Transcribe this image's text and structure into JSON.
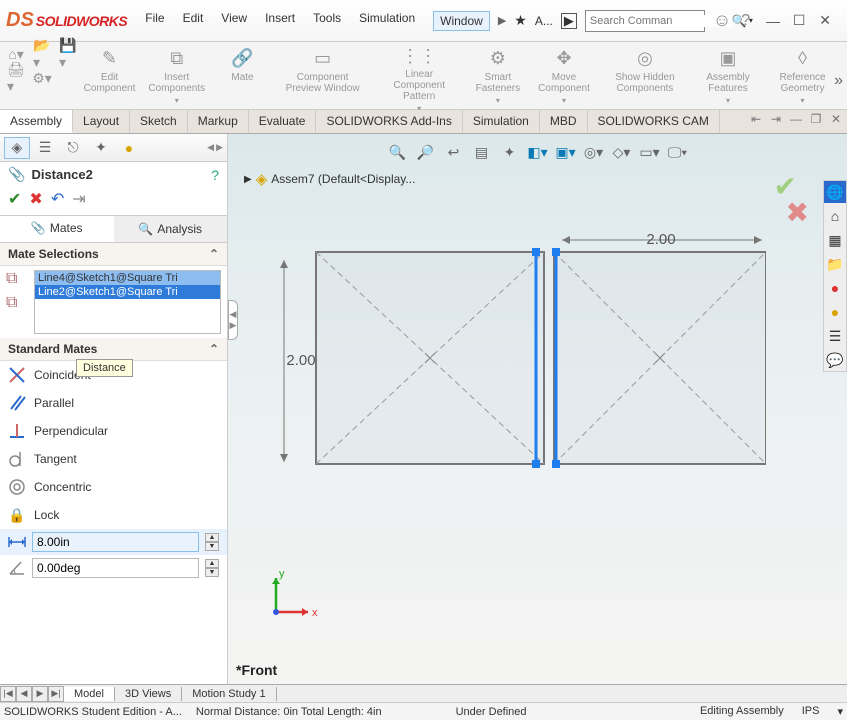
{
  "app": {
    "logo_prefix": "DS",
    "logo_text": "SOLIDWORKS",
    "menu": [
      "File",
      "Edit",
      "View",
      "Insert",
      "Tools",
      "Simulation",
      "Window"
    ],
    "menu_active_index": 6,
    "extra_btn": "A...",
    "search_placeholder": "Search Comman"
  },
  "ribbon": [
    {
      "label": "Edit Component"
    },
    {
      "label": "Insert Components"
    },
    {
      "label": "Mate"
    },
    {
      "label": "Component Preview Window"
    },
    {
      "label": "Linear Component Pattern"
    },
    {
      "label": "Smart Fasteners"
    },
    {
      "label": "Move Component"
    },
    {
      "label": "Show Hidden Components"
    },
    {
      "label": "Assembly Features"
    },
    {
      "label": "Reference Geometry"
    }
  ],
  "tabs": [
    "Assembly",
    "Layout",
    "Sketch",
    "Markup",
    "Evaluate",
    "SOLIDWORKS Add-Ins",
    "Simulation",
    "MBD",
    "SOLIDWORKS CAM"
  ],
  "tabs_active_index": 0,
  "panel": {
    "title": "Distance2",
    "toggle": {
      "mates": "Mates",
      "analysis": "Analysis"
    },
    "mate_selections_header": "Mate Selections",
    "selections": [
      "Line4@Sketch1@Square Tri",
      "Line2@Sketch1@Square Tri"
    ],
    "standard_mates_header": "Standard Mates",
    "mates": [
      "Coincident",
      "Parallel",
      "Perpendicular",
      "Tangent",
      "Concentric",
      "Lock"
    ],
    "distance_value": "8.00in",
    "angle_value": "0.00deg",
    "tooltip": "Distance"
  },
  "viewport": {
    "breadcrumb": "Assem7  (Default<Display...",
    "dim_h": "2.00",
    "dim_v": "2.00",
    "view_label": "*Front",
    "axes": {
      "x": "x",
      "y": "y"
    }
  },
  "bottom_tabs": [
    "Model",
    "3D Views",
    "Motion Study 1"
  ],
  "bottom_tabs_active_index": 0,
  "status": {
    "left1": "SOLIDWORKS Student Edition - A...",
    "left2": "Normal Distance: 0in Total Length: 4in",
    "center": "Under Defined",
    "right1": "Editing Assembly",
    "right2": "IPS"
  }
}
